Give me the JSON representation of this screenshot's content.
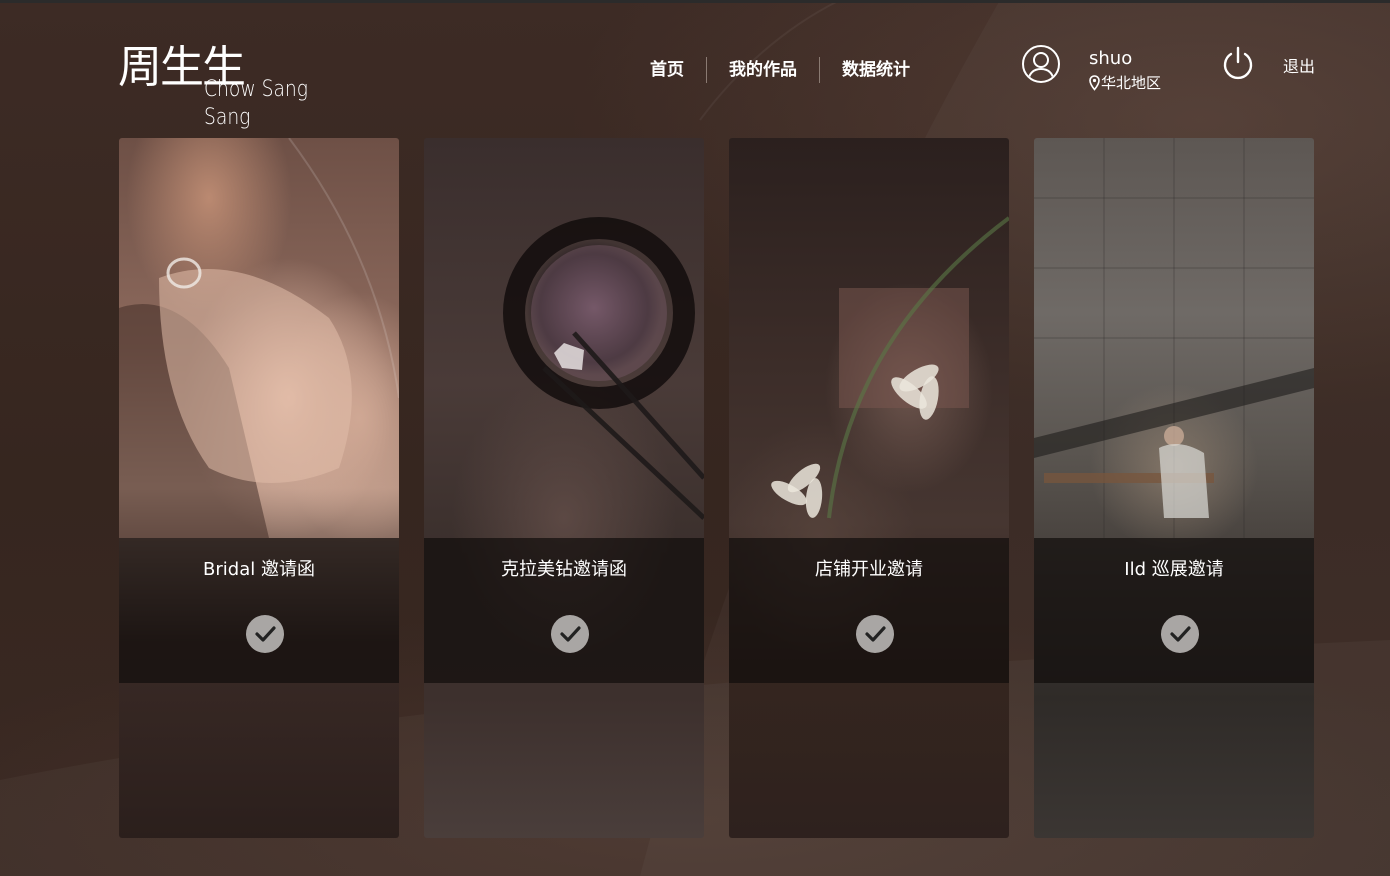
{
  "brand": {
    "name_cn": "周生生",
    "name_en": "Chow Sang Sang"
  },
  "nav": {
    "items": [
      {
        "label": "首页"
      },
      {
        "label": "我的作品"
      },
      {
        "label": "数据统计"
      }
    ]
  },
  "user": {
    "name": "shuo",
    "region": "华北地区",
    "avatar_icon": "user-icon",
    "location_icon": "location-pin-icon"
  },
  "logout": {
    "label": "退出",
    "icon": "power-icon"
  },
  "cards": [
    {
      "title": "Bridal 邀请函",
      "status_icon": "check-icon"
    },
    {
      "title": "克拉美钻邀请函",
      "status_icon": "check-icon"
    },
    {
      "title": "店铺开业邀请",
      "status_icon": "check-icon"
    },
    {
      "title": "Ild 巡展邀请",
      "status_icon": "check-icon"
    }
  ],
  "colors": {
    "background": "#3b2a24",
    "caption_overlay": "#120e0d",
    "check_badge": "#a9a6a4",
    "text": "#ffffff"
  }
}
